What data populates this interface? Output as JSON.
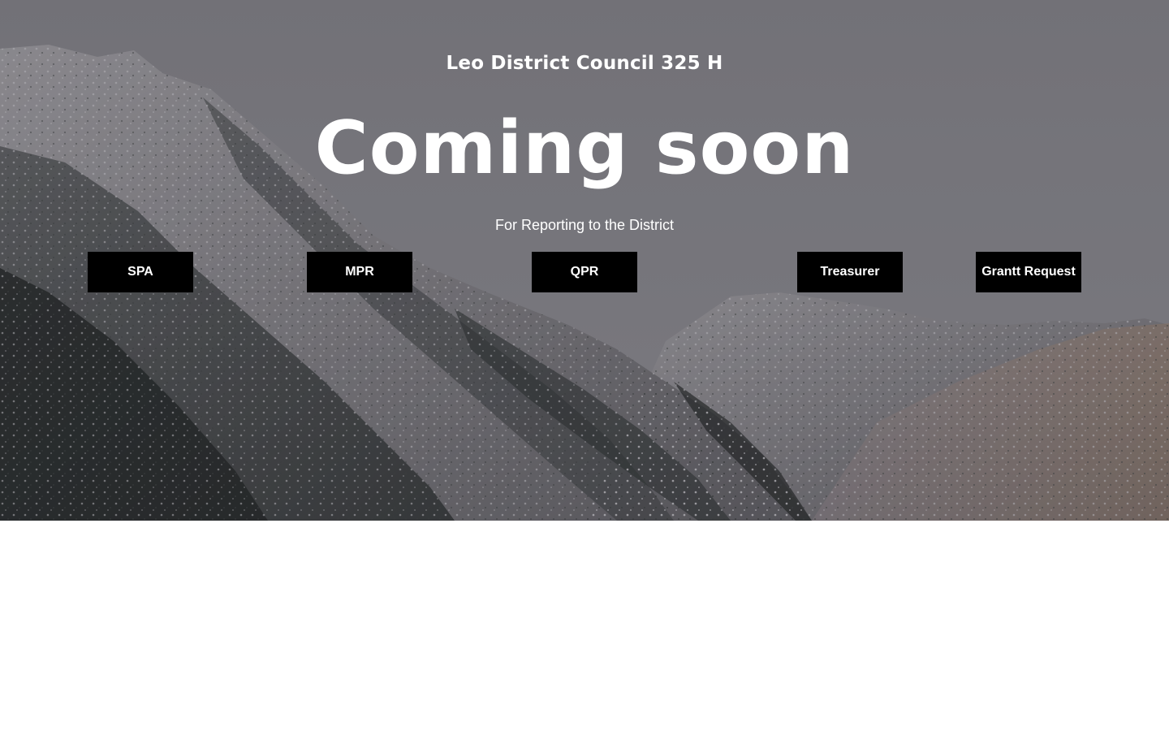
{
  "hero": {
    "site_title": "Leo District Council 325 H",
    "headline": "Coming soon",
    "subtitle": "For Reporting to the District"
  },
  "buttons": {
    "spa": "SPA",
    "mpr": "MPR",
    "qpr": "QPR",
    "treasurer": "Treasurer",
    "grant_request": "Grantt Request"
  },
  "colors": {
    "overlay": "#74737a",
    "button_bg": "#000000",
    "button_text": "#ffffff",
    "text": "#ffffff",
    "page_bg": "#ffffff"
  },
  "icons": {
    "background": "snowy-mountain-image"
  }
}
